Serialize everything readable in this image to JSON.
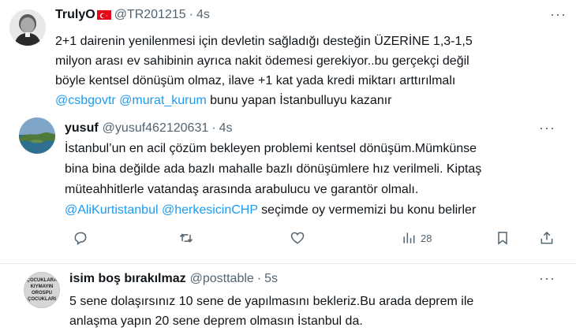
{
  "tweet1": {
    "name": "TrulyO",
    "handle": "@TR201215",
    "dot": "·",
    "time": "4s",
    "lines": [
      "2+1 dairenin yenilenmesi için devletin sağladığı desteğin ÜZERİNE 1,3-1,5",
      "milyon arası ev sahibinin ayrıca nakit ödemesi gerekiyor..bu gerçekçi değil",
      "böyle kentsel dönüşüm olmaz, ilave  +1 kat yada kredi miktarı arttırılmalı"
    ],
    "mention1": "@csbgovtr",
    "mention2": "@murat_kurum",
    "line4_rest": " bunu yapan İstanbulluyu kazanır"
  },
  "tweet2": {
    "name": "yusuf",
    "handle": "@yusuf462120631",
    "dot": "·",
    "time": "4s",
    "lines": [
      "İstanbul’un en acil çözüm bekleyen problemi kentsel dönüşüm.Mümkünse",
      "bina bina değilde ada bazlı mahalle bazlı dönüşümlere hız verilmeli. Kiptaş",
      "müteahhitlerle vatandaş arasında arabulucu ve garantör olmalı."
    ],
    "mention1": "@AliKurtistanbul",
    "mention2": "@herkesicinCHP",
    "line4_rest": " seçimde oy vermemizi bu konu belirler",
    "views": "28"
  },
  "tweet3": {
    "name": "isim boş bırakılmaz",
    "handle": "@posttable",
    "dot": "·",
    "time": "5s",
    "lines": [
      "5 sene dolaşırsınız 10 sene de yapılmasını bekleriz.Bu arada deprem ile",
      "anlaşma yapın 20 sene deprem olmasın İstanbul da."
    ],
    "avatar_text": [
      "ÇOCUKLARA",
      "KIYMAYIN",
      "OROSPU",
      "ÇOCUKLARI"
    ]
  },
  "more_label": "···",
  "colors": {
    "link": "#1d9bf0",
    "secondary": "#536471",
    "divider": "#e6ecf0",
    "flag": "#e30a17"
  }
}
